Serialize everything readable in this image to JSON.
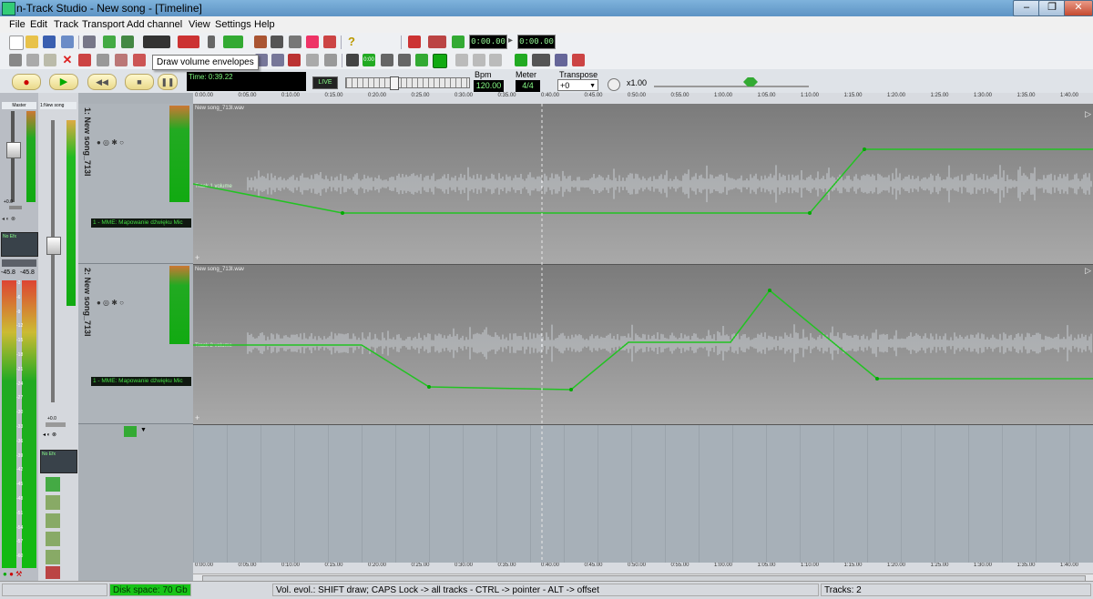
{
  "window": {
    "title": "n-Track Studio - New song - [Timeline]"
  },
  "menu": [
    "File",
    "Edit",
    "Track",
    "Transport",
    "Add channel",
    "View",
    "Settings",
    "Help"
  ],
  "tooltip": "Draw volume envelopes",
  "toolbar": {
    "time_start": "0:00.00",
    "time_end": "0:00.00"
  },
  "transport": {
    "time": "Time: 0:39.22",
    "live": "LIVE",
    "bpm_label": "Bpm",
    "bpm_value": "120.00",
    "meter_label": "Meter",
    "meter_value": "4/4",
    "transpose_label": "Transpose",
    "transpose_value": "+0",
    "speed": "x1.00"
  },
  "master": {
    "label": "Master",
    "level": "+0.0",
    "vu_left": "-45.8",
    "vu_right": "-45.8",
    "fx": "No Efx"
  },
  "channel": {
    "label": "1:New song",
    "level": "+0.0",
    "fx": "No Efx"
  },
  "ruler_ticks": [
    "0:00.00",
    "0:05.00",
    "0:10.00",
    "0:15.00",
    "0:20.00",
    "0:25.00",
    "0:30.00",
    "0:35.00",
    "0:40.00",
    "0:45.00",
    "0:50.00",
    "0:55.00",
    "1:00.00",
    "1:05.00",
    "1:10.00",
    "1:15.00",
    "1:20.00",
    "1:25.00",
    "1:30.00",
    "1:35.00",
    "1:40.00"
  ],
  "db_scale": [
    "-3",
    "-6",
    "-9",
    "-12",
    "-15",
    "-18",
    "-21",
    "-24",
    "-27",
    "-30",
    "-33",
    "-36",
    "-39",
    "-42",
    "-45",
    "-48",
    "-51",
    "-54",
    "-57",
    "-60"
  ],
  "tracks": [
    {
      "name": "1: New song_713I",
      "file": "New song_713I.wav",
      "env_label": "Track 1 volume",
      "device": "1 - MME: Mapowanie dźwięku Mic"
    },
    {
      "name": "2: New song_713I",
      "file": "New song_713I.wav",
      "env_label": "Track 2 volume",
      "device": "1 - MME: Mapowanie dźwięku Mic"
    }
  ],
  "status": {
    "disk": "Disk space: 70 Gb",
    "hint": "Vol. evol.: SHIFT draw; CAPS Lock -> all tracks - CTRL -> pointer - ALT -> offset",
    "tracks": "Tracks: 2"
  },
  "colors": {
    "envelope": "#22c322",
    "meter_green": "#1fb01f",
    "status_green": "#18c418"
  }
}
